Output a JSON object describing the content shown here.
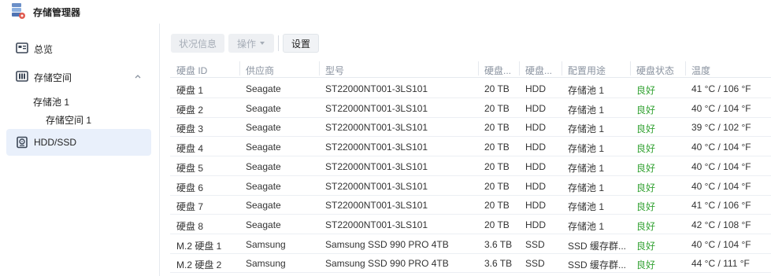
{
  "app": {
    "title": "存储管理器"
  },
  "sidebar": {
    "items": [
      {
        "label": "总览"
      },
      {
        "label": "存储空间"
      },
      {
        "label": "HDD/SSD"
      }
    ],
    "sub_items": [
      {
        "label": "存储池 1"
      },
      {
        "label": "存储空间 1"
      }
    ]
  },
  "toolbar": {
    "status_label": "状况信息",
    "action_label": "操作",
    "settings_label": "设置"
  },
  "table": {
    "columns": [
      "硬盘 ID",
      "供应商",
      "型号",
      "硬盘...",
      "硬盘...",
      "配置用途",
      "硬盘状态",
      "温度"
    ],
    "rows": [
      [
        "硬盘 1",
        "Seagate",
        "ST22000NT001-3LS101",
        "20 TB",
        "HDD",
        "存储池 1",
        "良好",
        "41 °C / 106 °F"
      ],
      [
        "硬盘 2",
        "Seagate",
        "ST22000NT001-3LS101",
        "20 TB",
        "HDD",
        "存储池 1",
        "良好",
        "40 °C / 104 °F"
      ],
      [
        "硬盘 3",
        "Seagate",
        "ST22000NT001-3LS101",
        "20 TB",
        "HDD",
        "存储池 1",
        "良好",
        "39 °C / 102 °F"
      ],
      [
        "硬盘 4",
        "Seagate",
        "ST22000NT001-3LS101",
        "20 TB",
        "HDD",
        "存储池 1",
        "良好",
        "40 °C / 104 °F"
      ],
      [
        "硬盘 5",
        "Seagate",
        "ST22000NT001-3LS101",
        "20 TB",
        "HDD",
        "存储池 1",
        "良好",
        "40 °C / 104 °F"
      ],
      [
        "硬盘 6",
        "Seagate",
        "ST22000NT001-3LS101",
        "20 TB",
        "HDD",
        "存储池 1",
        "良好",
        "40 °C / 104 °F"
      ],
      [
        "硬盘 7",
        "Seagate",
        "ST22000NT001-3LS101",
        "20 TB",
        "HDD",
        "存储池 1",
        "良好",
        "41 °C / 106 °F"
      ],
      [
        "硬盘 8",
        "Seagate",
        "ST22000NT001-3LS101",
        "20 TB",
        "HDD",
        "存储池 1",
        "良好",
        "42 °C / 108 °F"
      ],
      [
        "M.2 硬盘 1",
        "Samsung",
        "Samsung SSD 990 PRO 4TB",
        "3.6 TB",
        "SSD",
        "SSD 缓存群...",
        "良好",
        "40 °C / 104 °F"
      ],
      [
        "M.2 硬盘 2",
        "Samsung",
        "Samsung SSD 990 PRO 4TB",
        "3.6 TB",
        "SSD",
        "SSD 缓存群...",
        "良好",
        "44 °C / 111 °F"
      ]
    ]
  },
  "colors": {
    "status_good": "#35a335",
    "active_nav_bg": "#e9f0fb",
    "header_text": "#8a93a0"
  },
  "icons": [
    "storage-manager-icon",
    "overview-icon",
    "storage-space-icon",
    "chevron-up-icon",
    "hdd-icon"
  ]
}
